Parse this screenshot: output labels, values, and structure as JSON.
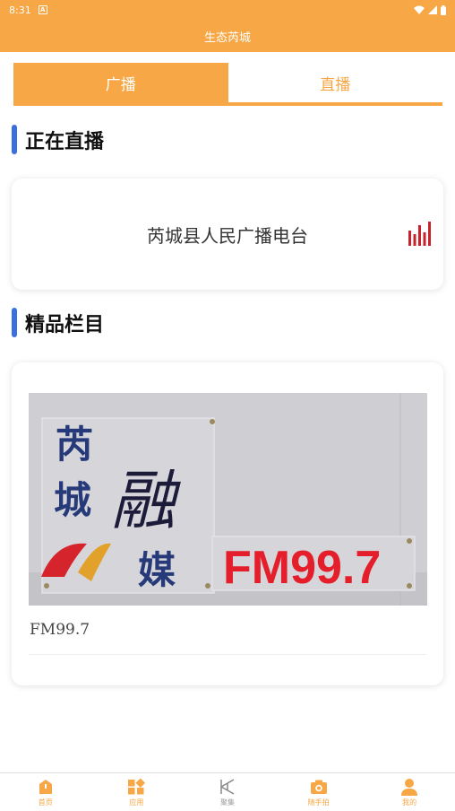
{
  "status_bar": {
    "time": "8:31",
    "notification_icon": "A"
  },
  "app_bar": {
    "title": "生态芮城"
  },
  "tabs": [
    {
      "label": "广播",
      "active": true
    },
    {
      "label": "直播",
      "active": false
    }
  ],
  "live_section": {
    "heading": "正在直播",
    "station_name": "芮城县人民广播电台",
    "indicator_icon": "equalizer-icon"
  },
  "featured_section": {
    "heading": "精品栏目",
    "program": {
      "title": "FM99.7",
      "image": {
        "line1": "芮",
        "line2": "城",
        "line3": "融",
        "line4": "媒",
        "frequency": "FM99.7"
      }
    }
  },
  "bottom_nav": {
    "items": [
      {
        "label": "首页",
        "icon": "home-icon"
      },
      {
        "label": "应用",
        "icon": "apps-icon"
      },
      {
        "label": "聚集",
        "icon": "gather-icon"
      },
      {
        "label": "随手拍",
        "icon": "camera-icon"
      },
      {
        "label": "我的",
        "icon": "user-icon"
      }
    ]
  },
  "colors": {
    "accent": "#f7a745",
    "section_bar": "#3a6fe0",
    "indicator": "#c8232c"
  }
}
